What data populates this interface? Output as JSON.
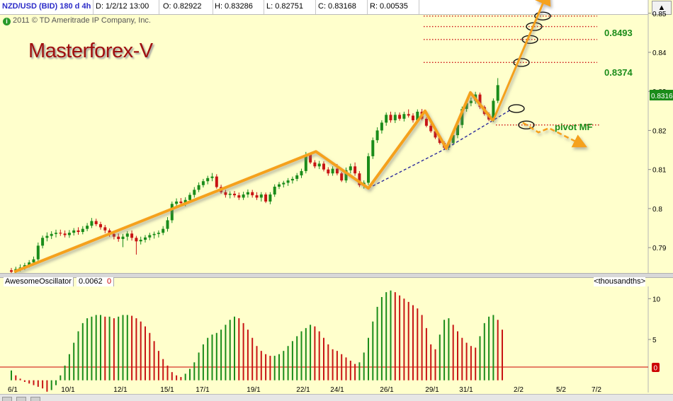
{
  "header": {
    "symbol": "NZD/USD (BID) 180 d 4h",
    "date": "D: 1/2/12 13:00",
    "open": "O: 0.82922",
    "high": "H: 0.83286",
    "low": "L: 0.82751",
    "close": "C: 0.83168",
    "range": "R: 0.00535",
    "expand_icon": "triangle-up-icon"
  },
  "copyright": "2011 © TD Ameritrade IP Company, Inc.",
  "brand": "Masterforex-V",
  "annotations": {
    "level_high": "0.8493",
    "level_low": "0.8374",
    "pivot": "pivot MF"
  },
  "last_price_tag": "0.8316",
  "oscillator": {
    "name": "AwesomeOscillator",
    "value": "0.0062",
    "zero": "0",
    "units": "<thousandths>",
    "zero_tag": "0"
  },
  "colors": {
    "background": "#ffffcc",
    "up": "#1a8c1a",
    "down": "#c81414",
    "pattern": "#f5a11e",
    "level": "#cc1010",
    "trend": "#2a2a9c",
    "label_green": "#1a8c1a"
  },
  "chart_data": [
    {
      "type": "candlestick",
      "title": "NZD/USD (BID) 180 d 4h",
      "x_ticks": [
        "6/1",
        "10/1",
        "12/1",
        "15/1",
        "17/1",
        "19/1",
        "22/1",
        "24/1",
        "26/1",
        "29/1",
        "31/1",
        "2/2",
        "5/2",
        "7/2"
      ],
      "y_ticks": [
        0.79,
        0.8,
        0.81,
        0.82,
        0.83,
        0.84,
        0.85
      ],
      "ylim": [
        0.7835,
        0.8534
      ],
      "grid": false,
      "series": [
        {
          "name": "NZD/USD",
          "ohlc": [
            [
              0.7842,
              0.7848,
              0.7832,
              0.7838
            ],
            [
              0.7838,
              0.7851,
              0.7832,
              0.7845
            ],
            [
              0.7845,
              0.7857,
              0.7839,
              0.7849
            ],
            [
              0.7849,
              0.7861,
              0.7843,
              0.7855
            ],
            [
              0.7855,
              0.7868,
              0.7849,
              0.7862
            ],
            [
              0.7862,
              0.7877,
              0.7855,
              0.787
            ],
            [
              0.787,
              0.7913,
              0.7864,
              0.7905
            ],
            [
              0.7905,
              0.7931,
              0.7898,
              0.7925
            ],
            [
              0.7925,
              0.7939,
              0.7916,
              0.793
            ],
            [
              0.793,
              0.7942,
              0.7922,
              0.7935
            ],
            [
              0.7935,
              0.7946,
              0.7926,
              0.7938
            ],
            [
              0.7938,
              0.7946,
              0.793,
              0.7936
            ],
            [
              0.7936,
              0.7944,
              0.7926,
              0.7932
            ],
            [
              0.7932,
              0.7945,
              0.7925,
              0.7938
            ],
            [
              0.7938,
              0.795,
              0.7931,
              0.7944
            ],
            [
              0.7944,
              0.7952,
              0.7933,
              0.794
            ],
            [
              0.794,
              0.7955,
              0.7934,
              0.7948
            ],
            [
              0.7948,
              0.7963,
              0.7942,
              0.7956
            ],
            [
              0.7956,
              0.7976,
              0.795,
              0.7968
            ],
            [
              0.7968,
              0.7974,
              0.7955,
              0.796
            ],
            [
              0.796,
              0.7966,
              0.7946,
              0.7952
            ],
            [
              0.7952,
              0.7958,
              0.7937,
              0.7944
            ],
            [
              0.7944,
              0.7949,
              0.7928,
              0.7935
            ],
            [
              0.7935,
              0.7943,
              0.7921,
              0.7928
            ],
            [
              0.7928,
              0.7936,
              0.7915,
              0.7922
            ],
            [
              0.7922,
              0.7935,
              0.7901,
              0.7928
            ],
            [
              0.7928,
              0.7942,
              0.7918,
              0.7936
            ],
            [
              0.7936,
              0.7944,
              0.7918,
              0.7925
            ],
            [
              0.7925,
              0.793,
              0.7882,
              0.7916
            ],
            [
              0.7916,
              0.7928,
              0.7908,
              0.792
            ],
            [
              0.792,
              0.7932,
              0.7913,
              0.7926
            ],
            [
              0.7926,
              0.7938,
              0.7919,
              0.7932
            ],
            [
              0.7932,
              0.7941,
              0.7923,
              0.7935
            ],
            [
              0.7935,
              0.7944,
              0.7926,
              0.7938
            ],
            [
              0.7938,
              0.7955,
              0.7932,
              0.7948
            ],
            [
              0.7948,
              0.7978,
              0.7941,
              0.797
            ],
            [
              0.797,
              0.8018,
              0.7963,
              0.8012
            ],
            [
              0.8012,
              0.8026,
              0.8004,
              0.8018
            ],
            [
              0.8018,
              0.8027,
              0.8006,
              0.8014
            ],
            [
              0.8014,
              0.8029,
              0.8006,
              0.8022
            ],
            [
              0.8022,
              0.8041,
              0.8016,
              0.8035
            ],
            [
              0.8035,
              0.8055,
              0.8028,
              0.8048
            ],
            [
              0.8048,
              0.8067,
              0.8042,
              0.806
            ],
            [
              0.806,
              0.8076,
              0.8054,
              0.807
            ],
            [
              0.807,
              0.8084,
              0.8062,
              0.8078
            ],
            [
              0.8078,
              0.8091,
              0.807,
              0.8082
            ],
            [
              0.8082,
              0.8088,
              0.8051,
              0.8055
            ],
            [
              0.8055,
              0.8061,
              0.8038,
              0.8042
            ],
            [
              0.8042,
              0.8048,
              0.8028,
              0.8035
            ],
            [
              0.8035,
              0.8044,
              0.8026,
              0.8038
            ],
            [
              0.8038,
              0.8045,
              0.8028,
              0.8034
            ],
            [
              0.8034,
              0.8041,
              0.8022,
              0.8028
            ],
            [
              0.8028,
              0.8043,
              0.8022,
              0.8036
            ],
            [
              0.8036,
              0.8049,
              0.8028,
              0.8042
            ],
            [
              0.8042,
              0.8048,
              0.8028,
              0.8034
            ],
            [
              0.8034,
              0.8042,
              0.8022,
              0.8028
            ],
            [
              0.8028,
              0.8042,
              0.8018,
              0.8036
            ],
            [
              0.8036,
              0.8041,
              0.8014,
              0.8018
            ],
            [
              0.8018,
              0.8042,
              0.8011,
              0.8036
            ],
            [
              0.8036,
              0.8062,
              0.803,
              0.8056
            ],
            [
              0.8056,
              0.8068,
              0.805,
              0.8062
            ],
            [
              0.8062,
              0.8071,
              0.8054,
              0.8066
            ],
            [
              0.8066,
              0.8078,
              0.8058,
              0.8072
            ],
            [
              0.8072,
              0.8082,
              0.8064,
              0.8076
            ],
            [
              0.8076,
              0.8091,
              0.807,
              0.8085
            ],
            [
              0.8085,
              0.8102,
              0.8078,
              0.8096
            ],
            [
              0.8096,
              0.8145,
              0.809,
              0.8138
            ],
            [
              0.8138,
              0.8142,
              0.8114,
              0.8118
            ],
            [
              0.8118,
              0.8124,
              0.8103,
              0.8108
            ],
            [
              0.8108,
              0.8122,
              0.8101,
              0.8115
            ],
            [
              0.8115,
              0.8121,
              0.8095,
              0.81
            ],
            [
              0.81,
              0.8106,
              0.8084,
              0.809
            ],
            [
              0.809,
              0.8108,
              0.8084,
              0.8102
            ],
            [
              0.8102,
              0.8114,
              0.8085,
              0.809
            ],
            [
              0.809,
              0.8094,
              0.8068,
              0.8072
            ],
            [
              0.8072,
              0.8105,
              0.8066,
              0.8098
            ],
            [
              0.8098,
              0.8115,
              0.809,
              0.8108
            ],
            [
              0.8108,
              0.8118,
              0.8084,
              0.809
            ],
            [
              0.809,
              0.8096,
              0.8055,
              0.806
            ],
            [
              0.806,
              0.8072,
              0.8051,
              0.8066
            ],
            [
              0.8066,
              0.8142,
              0.806,
              0.8134
            ],
            [
              0.8134,
              0.8182,
              0.8127,
              0.8175
            ],
            [
              0.8175,
              0.8208,
              0.8168,
              0.82
            ],
            [
              0.82,
              0.8226,
              0.8192,
              0.822
            ],
            [
              0.822,
              0.8246,
              0.8212,
              0.824
            ],
            [
              0.824,
              0.8248,
              0.822,
              0.8226
            ],
            [
              0.8226,
              0.8247,
              0.8219,
              0.824
            ],
            [
              0.824,
              0.8246,
              0.8225,
              0.823
            ],
            [
              0.823,
              0.8248,
              0.8223,
              0.8242
            ],
            [
              0.8242,
              0.8254,
              0.8233,
              0.8238
            ],
            [
              0.8238,
              0.8244,
              0.822,
              0.8226
            ],
            [
              0.8226,
              0.8254,
              0.822,
              0.8248
            ],
            [
              0.8248,
              0.8255,
              0.8226,
              0.823
            ],
            [
              0.823,
              0.8234,
              0.8208,
              0.8212
            ],
            [
              0.8212,
              0.8217,
              0.8194,
              0.8198
            ],
            [
              0.8198,
              0.8203,
              0.8178,
              0.8182
            ],
            [
              0.8182,
              0.8187,
              0.8164,
              0.8168
            ],
            [
              0.8168,
              0.8172,
              0.8152,
              0.8156
            ],
            [
              0.8156,
              0.8174,
              0.815,
              0.8168
            ],
            [
              0.8168,
              0.8194,
              0.8162,
              0.8188
            ],
            [
              0.8188,
              0.8221,
              0.818,
              0.8214
            ],
            [
              0.8214,
              0.8261,
              0.8206,
              0.8255
            ],
            [
              0.8255,
              0.8276,
              0.8248,
              0.827
            ],
            [
              0.827,
              0.8284,
              0.8262,
              0.8276
            ],
            [
              0.8276,
              0.8299,
              0.8268,
              0.8292
            ],
            [
              0.8292,
              0.8297,
              0.8255,
              0.826
            ],
            [
              0.826,
              0.8264,
              0.8238,
              0.8242
            ],
            [
              0.8242,
              0.8246,
              0.8224,
              0.8228
            ],
            [
              0.8228,
              0.8282,
              0.8222,
              0.8276
            ],
            [
              0.8276,
              0.8334,
              0.827,
              0.8316
            ]
          ]
        }
      ],
      "annotations": {
        "resistance_levels": [
          0.8493,
          0.8466,
          0.8433,
          0.8374
        ],
        "pivot_level": 0.8214
      }
    },
    {
      "type": "bar",
      "title": "AwesomeOscillator",
      "units": "<thousandths>",
      "y_ticks": [
        0,
        5,
        10
      ],
      "ylim": [
        -1.5,
        11.5
      ],
      "series": [
        {
          "name": "AwesomeOscillator",
          "values": [
            1.2,
            0.6,
            0.2,
            -0.2,
            -0.4,
            -0.6,
            -0.8,
            -1.0,
            -1.4,
            -1.2,
            -0.6,
            0.6,
            1.8,
            3.2,
            4.6,
            6.0,
            7.0,
            7.6,
            7.8,
            8.0,
            8.0,
            7.8,
            7.8,
            7.6,
            7.8,
            8.0,
            8.0,
            7.9,
            7.6,
            7.2,
            6.6,
            5.8,
            4.8,
            3.6,
            2.6,
            1.8,
            1.0,
            0.6,
            0.4,
            0.8,
            1.4,
            2.2,
            3.4,
            4.4,
            5.2,
            5.6,
            5.8,
            6.2,
            6.8,
            7.4,
            7.8,
            7.6,
            7.0,
            6.2,
            5.2,
            4.2,
            3.6,
            3.2,
            3.0,
            3.0,
            3.2,
            3.6,
            4.2,
            4.8,
            5.4,
            6.0,
            6.4,
            6.8,
            6.6,
            6.0,
            5.2,
            4.4,
            3.8,
            3.6,
            3.2,
            2.8,
            2.4,
            2.0,
            2.2,
            3.4,
            5.2,
            7.2,
            9.0,
            10.2,
            10.8,
            11.0,
            10.8,
            10.4,
            10.0,
            9.6,
            9.2,
            8.8,
            8.0,
            6.4,
            4.4,
            3.8,
            5.6,
            7.4,
            7.6,
            6.8,
            6.0,
            5.2,
            4.6,
            4.2,
            4.0,
            5.4,
            7.0,
            7.8,
            8.0,
            7.4,
            6.2
          ]
        }
      ]
    }
  ]
}
